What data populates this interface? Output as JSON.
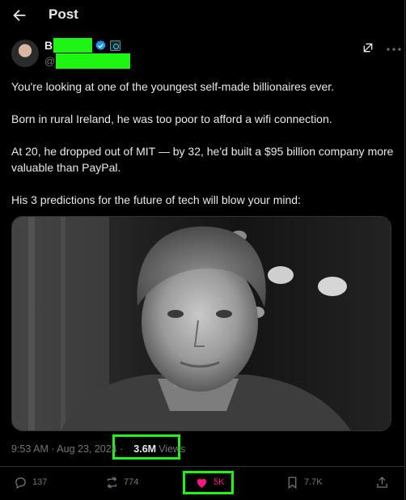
{
  "header": {
    "title": "Post"
  },
  "author": {
    "name_visible": "B",
    "handle_visible": "@"
  },
  "post": {
    "paragraphs": [
      "You're looking at one of the youngest self-made billionaires ever.",
      "Born in rural Ireland, he was too poor to afford a wifi connection.",
      "At 20, he dropped out of MIT — by 32, he'd built a $95 billion company more valuable than PayPal.",
      "His 3 predictions for the future of tech will blow your mind:"
    ]
  },
  "meta": {
    "timestamp": "9:53 AM · Aug 23, 2024 ·",
    "views_count": "3.6M",
    "views_label": "Views"
  },
  "actions": {
    "replies": "137",
    "reposts": "774",
    "likes": "5K",
    "bookmarks": "7.7K"
  },
  "colors": {
    "background": "#000000",
    "text": "#e7e9ea",
    "secondary": "#71767b",
    "like": "#f91880",
    "verified": "#1d9bf0",
    "annotation": "#1ff512"
  },
  "icons": [
    "back-arrow-icon",
    "verified-badge-icon",
    "affiliation-icon",
    "grok-icon",
    "more-icon",
    "reply-icon",
    "repost-icon",
    "like-icon",
    "bookmark-icon",
    "share-icon"
  ]
}
